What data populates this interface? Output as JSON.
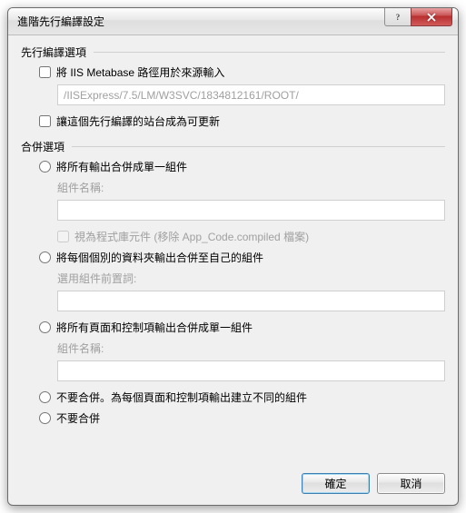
{
  "window": {
    "title": "進階先行編譯設定"
  },
  "precompile": {
    "group_title": "先行編譯選項",
    "use_metabase_label": "將 IIS Metabase 路徑用於來源輸入",
    "metabase_path": "/IISExpress/7.5/LM/W3SVC/1834812161/ROOT/",
    "updatable_label": "讓這個先行編譯的站台成為可更新"
  },
  "merge": {
    "group_title": "合併選項",
    "opt_single": {
      "label": "將所有輸出合併成單一組件",
      "assembly_label": "組件名稱:",
      "assembly_value": "",
      "treat_as_lib_label": "視為程式庫元件 (移除 App_Code.compiled 檔案)"
    },
    "opt_folder": {
      "label": "將每個個別的資料夾輸出合併至自己的組件",
      "prefix_label": "選用組件前置詞:",
      "prefix_value": ""
    },
    "opt_pages": {
      "label": "將所有頁面和控制項輸出合併成單一組件",
      "assembly_label": "組件名稱:",
      "assembly_value": ""
    },
    "opt_none_each": {
      "label": "不要合併。為每個頁面和控制項輸出建立不同的組件"
    },
    "opt_none": {
      "label": "不要合併"
    }
  },
  "buttons": {
    "ok": "確定",
    "cancel": "取消"
  }
}
